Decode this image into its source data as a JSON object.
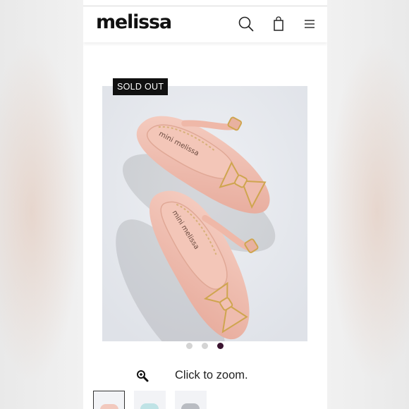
{
  "header": {
    "logo_text": "melissa",
    "icons": [
      "search-icon",
      "shopping-bag-icon",
      "hamburger-menu-icon"
    ]
  },
  "product": {
    "badge": "SOLD OUT",
    "image_brand_text": "mini melissa",
    "gallery": {
      "dot_count": 3,
      "active_index": 2,
      "active_color": "#3b1430"
    }
  },
  "zoom": {
    "icon": "magnifier-plus-icon",
    "label": "Click to zoom."
  },
  "thumbnails": [
    {
      "color": "pink"
    },
    {
      "color": "light-blue"
    },
    {
      "color": "silver"
    }
  ],
  "colors": {
    "shoe_pink": "#f0c2b4",
    "accent_gold": "#cfa54f",
    "image_background": "#e6e8ed"
  }
}
